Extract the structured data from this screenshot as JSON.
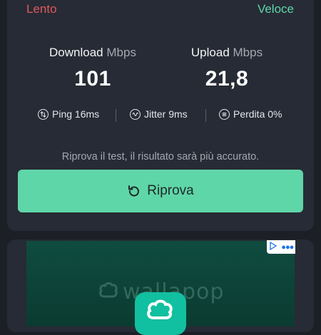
{
  "speed_scale": {
    "slow_label": "Lento",
    "fast_label": "Veloce"
  },
  "download": {
    "label": "Download",
    "unit": "Mbps",
    "value": "101"
  },
  "upload": {
    "label": "Upload",
    "unit": "Mbps",
    "value": "21,8"
  },
  "stats": {
    "ping": "Ping 16ms",
    "jitter": "Jitter 9ms",
    "loss": "Perdita 0%"
  },
  "hint": "Riprova il test, il risultato sarà più accurato.",
  "retry_button": {
    "label": "Riprova"
  },
  "ad": {
    "brand": "wallapop"
  },
  "colors": {
    "accent": "#5fd6a8",
    "slow": "#e0575b",
    "background": "#1c1f26",
    "card": "#272b35"
  }
}
